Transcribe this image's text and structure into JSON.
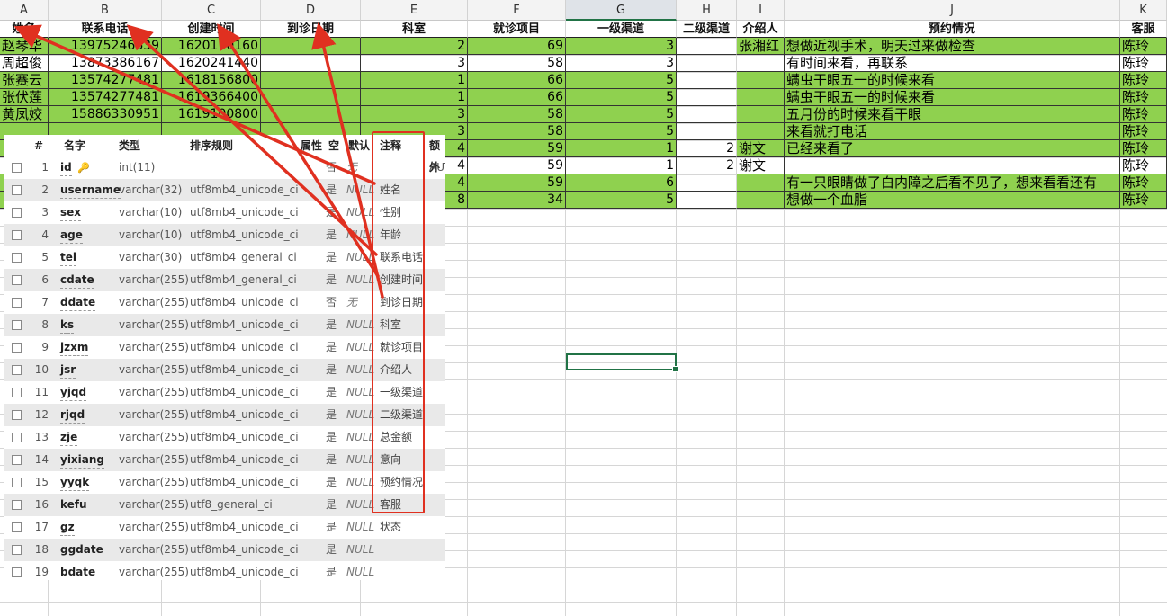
{
  "columns": [
    "A",
    "B",
    "C",
    "D",
    "E",
    "F",
    "G",
    "H",
    "I",
    "J",
    "K"
  ],
  "selected_column": "G",
  "headers": [
    "姓名",
    "联系电话",
    "创建时间",
    "到诊日期",
    "科室",
    "就诊项目",
    "一级渠道",
    "二级渠道",
    "介绍人",
    "预约情况",
    "客服"
  ],
  "rows": [
    {
      "name": "赵琴华",
      "tel": "13975246639",
      "cdate": "1620110160",
      "ddate": "",
      "ks": "2",
      "jzxm": "69",
      "yjqd": "3",
      "rjqd": "",
      "jsr": "张湘红",
      "yyqk": "想做近视手术，明天过来做检查",
      "kefu": "陈玲",
      "green": true
    },
    {
      "name": "周超俊",
      "tel": "13873386167",
      "cdate": "1620241440",
      "ddate": "",
      "ks": "3",
      "jzxm": "58",
      "yjqd": "3",
      "rjqd": "",
      "jsr": "",
      "yyqk": "有时间来看，再联系",
      "kefu": "陈玲",
      "green": false
    },
    {
      "name": "张赛云",
      "tel": "13574277481",
      "cdate": "1618156800",
      "ddate": "",
      "ks": "1",
      "jzxm": "66",
      "yjqd": "5",
      "rjqd": "",
      "jsr": "",
      "yyqk": "螨虫干眼五一的时候来看",
      "kefu": "陈玲",
      "green": true
    },
    {
      "name": "张伏莲",
      "tel": "13574277481",
      "cdate": "1619366400",
      "ddate": "",
      "ks": "1",
      "jzxm": "66",
      "yjqd": "5",
      "rjqd": "",
      "jsr": "",
      "yyqk": "螨虫干眼五一的时候来看",
      "kefu": "陈玲",
      "green": true
    },
    {
      "name": "黄凤姣",
      "tel": "15886330951",
      "cdate": "1619100800",
      "ddate": "",
      "ks": "3",
      "jzxm": "58",
      "yjqd": "5",
      "rjqd": "",
      "jsr": "",
      "yyqk": "五月份的时候来看干眼",
      "kefu": "陈玲",
      "green": true
    },
    {
      "name": "",
      "tel": "",
      "cdate": "",
      "ddate": "",
      "ks": "3",
      "jzxm": "58",
      "yjqd": "5",
      "rjqd": "",
      "jsr": "",
      "yyqk": "来看就打电话",
      "kefu": "陈玲",
      "green": true
    },
    {
      "name": "",
      "tel": "",
      "cdate": "",
      "ddate": "",
      "ks": "4",
      "jzxm": "59",
      "yjqd": "1",
      "rjqd": "2",
      "jsr": "谢文",
      "yyqk": "已经来看了",
      "kefu": "陈玲",
      "green": true
    },
    {
      "name": "",
      "tel": "",
      "cdate": "",
      "ddate": "",
      "ks": "4",
      "jzxm": "59",
      "yjqd": "1",
      "rjqd": "2",
      "jsr": "谢文",
      "yyqk": "",
      "kefu": "陈玲",
      "green": false
    },
    {
      "name": "",
      "tel": "",
      "cdate": "",
      "ddate": "",
      "ks": "4",
      "jzxm": "59",
      "yjqd": "6",
      "rjqd": "",
      "jsr": "",
      "yyqk": "有一只眼睛做了白内障之后看不见了，想来看看还有",
      "kefu": "陈玲",
      "green": true
    },
    {
      "name": "",
      "tel": "",
      "cdate": "",
      "ddate": "",
      "ks": "8",
      "jzxm": "34",
      "yjqd": "5",
      "rjqd": "",
      "jsr": "",
      "yyqk": "想做一个血脂",
      "kefu": "陈玲",
      "green": true
    }
  ],
  "panel": {
    "headers": {
      "num": "#",
      "name": "名字",
      "type": "类型",
      "collation": "排序规则",
      "attr": "属性",
      "null": "空",
      "default": "默认",
      "comment": "注释",
      "extra": "额外"
    },
    "fields": [
      {
        "num": "1",
        "name": "id",
        "key": true,
        "type": "int(11)",
        "collation": "",
        "null": "否",
        "default": "无",
        "comment": "",
        "extra": "AUTO_INCREMENT"
      },
      {
        "num": "2",
        "name": "username",
        "type": "varchar(32)",
        "collation": "utf8mb4_unicode_ci",
        "null": "是",
        "default": "NULL",
        "comment": "姓名"
      },
      {
        "num": "3",
        "name": "sex",
        "type": "varchar(10)",
        "collation": "utf8mb4_unicode_ci",
        "null": "是",
        "default": "NULL",
        "comment": "性别"
      },
      {
        "num": "4",
        "name": "age",
        "type": "varchar(10)",
        "collation": "utf8mb4_unicode_ci",
        "null": "是",
        "default": "NULL",
        "comment": "年龄"
      },
      {
        "num": "5",
        "name": "tel",
        "type": "varchar(30)",
        "collation": "utf8mb4_general_ci",
        "null": "是",
        "default": "NULL",
        "comment": "联系电话"
      },
      {
        "num": "6",
        "name": "cdate",
        "type": "varchar(255)",
        "collation": "utf8mb4_general_ci",
        "null": "是",
        "default": "NULL",
        "comment": "创建时间"
      },
      {
        "num": "7",
        "name": "ddate",
        "type": "varchar(255)",
        "collation": "utf8mb4_unicode_ci",
        "null": "否",
        "default": "无",
        "comment": "到诊日期"
      },
      {
        "num": "8",
        "name": "ks",
        "type": "varchar(255)",
        "collation": "utf8mb4_unicode_ci",
        "null": "是",
        "default": "NULL",
        "comment": "科室"
      },
      {
        "num": "9",
        "name": "jzxm",
        "type": "varchar(255)",
        "collation": "utf8mb4_unicode_ci",
        "null": "是",
        "default": "NULL",
        "comment": "就诊项目"
      },
      {
        "num": "10",
        "name": "jsr",
        "type": "varchar(255)",
        "collation": "utf8mb4_unicode_ci",
        "null": "是",
        "default": "NULL",
        "comment": "介绍人"
      },
      {
        "num": "11",
        "name": "yjqd",
        "type": "varchar(255)",
        "collation": "utf8mb4_unicode_ci",
        "null": "是",
        "default": "NULL",
        "comment": "一级渠道"
      },
      {
        "num": "12",
        "name": "rjqd",
        "type": "varchar(255)",
        "collation": "utf8mb4_unicode_ci",
        "null": "是",
        "default": "NULL",
        "comment": "二级渠道"
      },
      {
        "num": "13",
        "name": "zje",
        "type": "varchar(255)",
        "collation": "utf8mb4_unicode_ci",
        "null": "是",
        "default": "NULL",
        "comment": "总金额"
      },
      {
        "num": "14",
        "name": "yixiang",
        "type": "varchar(255)",
        "collation": "utf8mb4_unicode_ci",
        "null": "是",
        "default": "NULL",
        "comment": "意向"
      },
      {
        "num": "15",
        "name": "yyqk",
        "type": "varchar(255)",
        "collation": "utf8mb4_unicode_ci",
        "null": "是",
        "default": "NULL",
        "comment": "预约情况"
      },
      {
        "num": "16",
        "name": "kefu",
        "type": "varchar(255)",
        "collation": "utf8_general_ci",
        "null": "是",
        "default": "NULL",
        "comment": "客服"
      },
      {
        "num": "17",
        "name": "gz",
        "type": "varchar(255)",
        "collation": "utf8mb4_unicode_ci",
        "null": "是",
        "default": "NULL",
        "comment": "状态"
      },
      {
        "num": "18",
        "name": "ggdate",
        "type": "varchar(255)",
        "collation": "utf8mb4_unicode_ci",
        "null": "是",
        "default": "NULL",
        "comment": ""
      },
      {
        "num": "19",
        "name": "bdate",
        "type": "varchar(255)",
        "collation": "utf8mb4_unicode_ci",
        "null": "是",
        "default": "NULL",
        "comment": ""
      }
    ]
  },
  "colors": {
    "green_fill": "#8fd14f",
    "annotation_red": "#e03020",
    "selection": "#217346"
  }
}
